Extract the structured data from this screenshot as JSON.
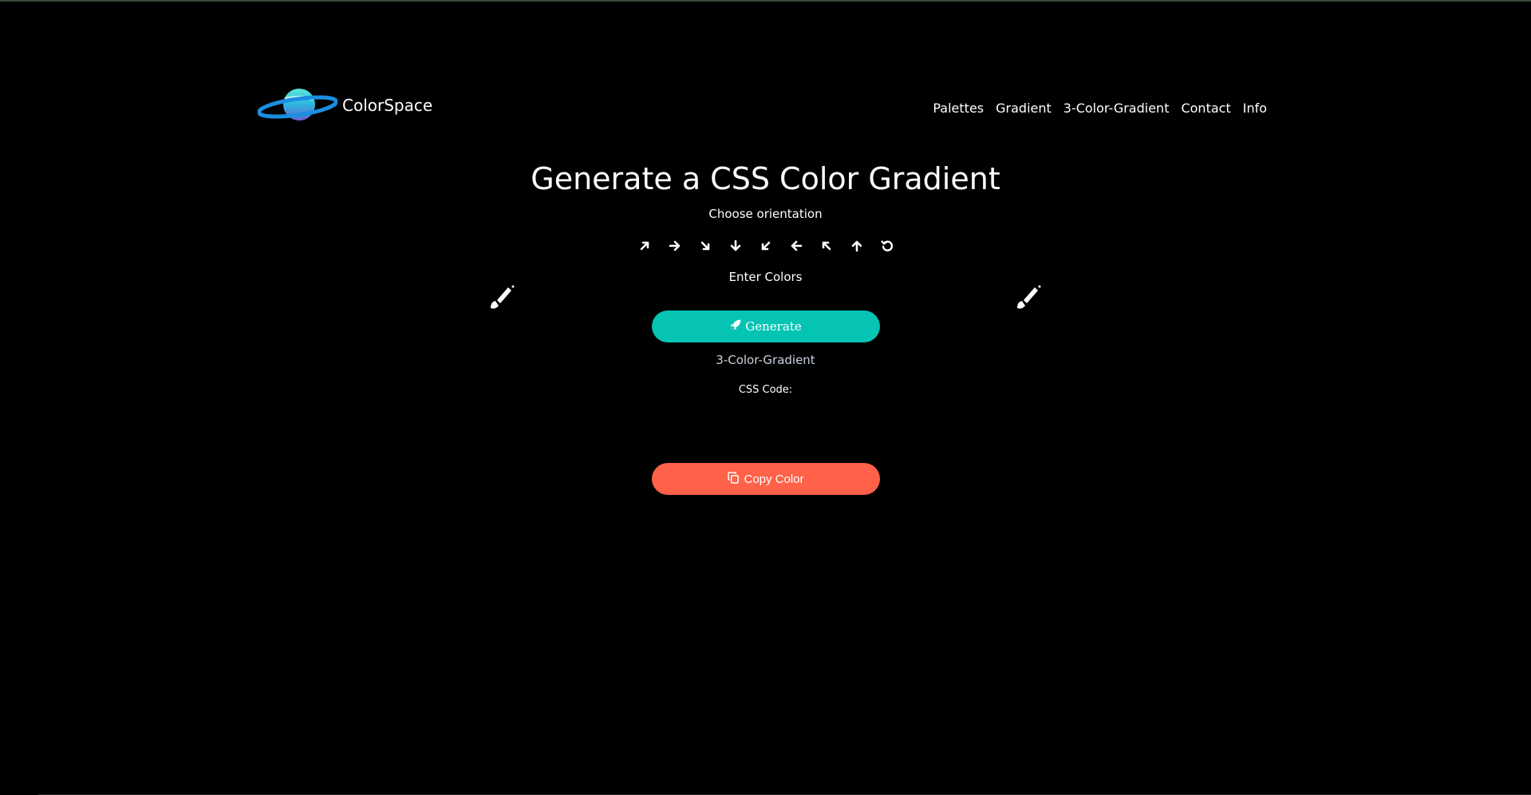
{
  "brand": {
    "name": "ColorSpace",
    "logo_icon": "planet-icon"
  },
  "nav": [
    {
      "label": "Palettes"
    },
    {
      "label": "Gradient"
    },
    {
      "label": "3-Color-Gradient"
    },
    {
      "label": "Contact"
    },
    {
      "label": "Info"
    }
  ],
  "main": {
    "title": "Generate a CSS Color Gradient",
    "choose_orientation": "Choose orientation",
    "orientations": [
      "arrow-up-right-icon",
      "arrow-right-icon",
      "arrow-down-right-icon",
      "arrow-down-icon",
      "arrow-down-left-icon",
      "arrow-left-icon",
      "arrow-up-left-icon",
      "arrow-up-icon",
      "radial-refresh-icon"
    ],
    "enter_colors": "Enter Colors",
    "generate_label": "Generate",
    "three_color_link": "3-Color-Gradient",
    "css_code_label": "CSS Code:",
    "copy_label": "Copy Color"
  },
  "colors": {
    "background": "#000000",
    "generate": "#06c4b4",
    "copy": "#ff6149",
    "link": "#c8d2dc"
  }
}
